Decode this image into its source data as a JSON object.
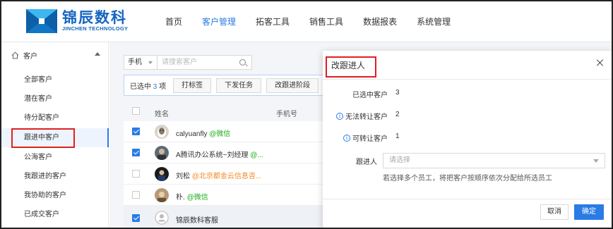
{
  "brand": {
    "name_cn": "锦辰数科",
    "name_en": "JINCHEN TECHNOLOGY",
    "color": "#1565c0"
  },
  "nav": {
    "items": [
      {
        "label": "首页",
        "active": false
      },
      {
        "label": "客户管理",
        "active": true
      },
      {
        "label": "拓客工具",
        "active": false
      },
      {
        "label": "销售工具",
        "active": false
      },
      {
        "label": "数据报表",
        "active": false
      },
      {
        "label": "系统管理",
        "active": false
      }
    ],
    "active_color": "#2a7be4"
  },
  "sidebar": {
    "section_title": "客户",
    "section_icon": "home-icon",
    "items": [
      {
        "label": "全部客户",
        "active": false
      },
      {
        "label": "潜在客户",
        "active": false
      },
      {
        "label": "待分配客户",
        "active": false
      },
      {
        "label": "跟进中客户",
        "active": true
      },
      {
        "label": "公海客户",
        "active": false
      },
      {
        "label": "我跟进的客户",
        "active": false
      },
      {
        "label": "我协助的客户",
        "active": false
      },
      {
        "label": "已成交客户",
        "active": false
      }
    ]
  },
  "filter": {
    "field_select": "手机",
    "search_placeholder": "请搜索客户"
  },
  "batch_bar": {
    "selected_prefix": "已选中",
    "selected_count": "3",
    "selected_suffix": "项",
    "buttons": [
      "打标签",
      "下发任务",
      "改跟进阶段"
    ]
  },
  "table": {
    "columns": [
      "姓名",
      "手机号"
    ],
    "rows": [
      {
        "checked": true,
        "name": "calyuanfly",
        "tag": "@微信",
        "tag_type": "wx"
      },
      {
        "checked": true,
        "name": "A腾讯办公系统~刘经理",
        "tag": "@...",
        "tag_type": "wx"
      },
      {
        "checked": false,
        "name": "刘松",
        "tag": "@北京都金云信息咨...",
        "tag_type": "org"
      },
      {
        "checked": false,
        "name": "朴.",
        "tag": "@微信",
        "tag_type": "wx"
      },
      {
        "checked": true,
        "name": "锦辰数科客服",
        "tag": "",
        "tag_type": "none"
      }
    ]
  },
  "dialog": {
    "title": "改跟进人",
    "fields": [
      {
        "label": "已选中客户",
        "value": "3",
        "info": false
      },
      {
        "label": "无法转让客户",
        "value": "2",
        "info": true
      },
      {
        "label": "可转让客户",
        "value": "1",
        "info": true
      }
    ],
    "assignee_label": "跟进人",
    "assignee_placeholder": "请选择",
    "hint": "若选择多个员工，将把客户按顺序依次分配给所选员工",
    "cancel_label": "取消",
    "ok_label": "确定"
  }
}
